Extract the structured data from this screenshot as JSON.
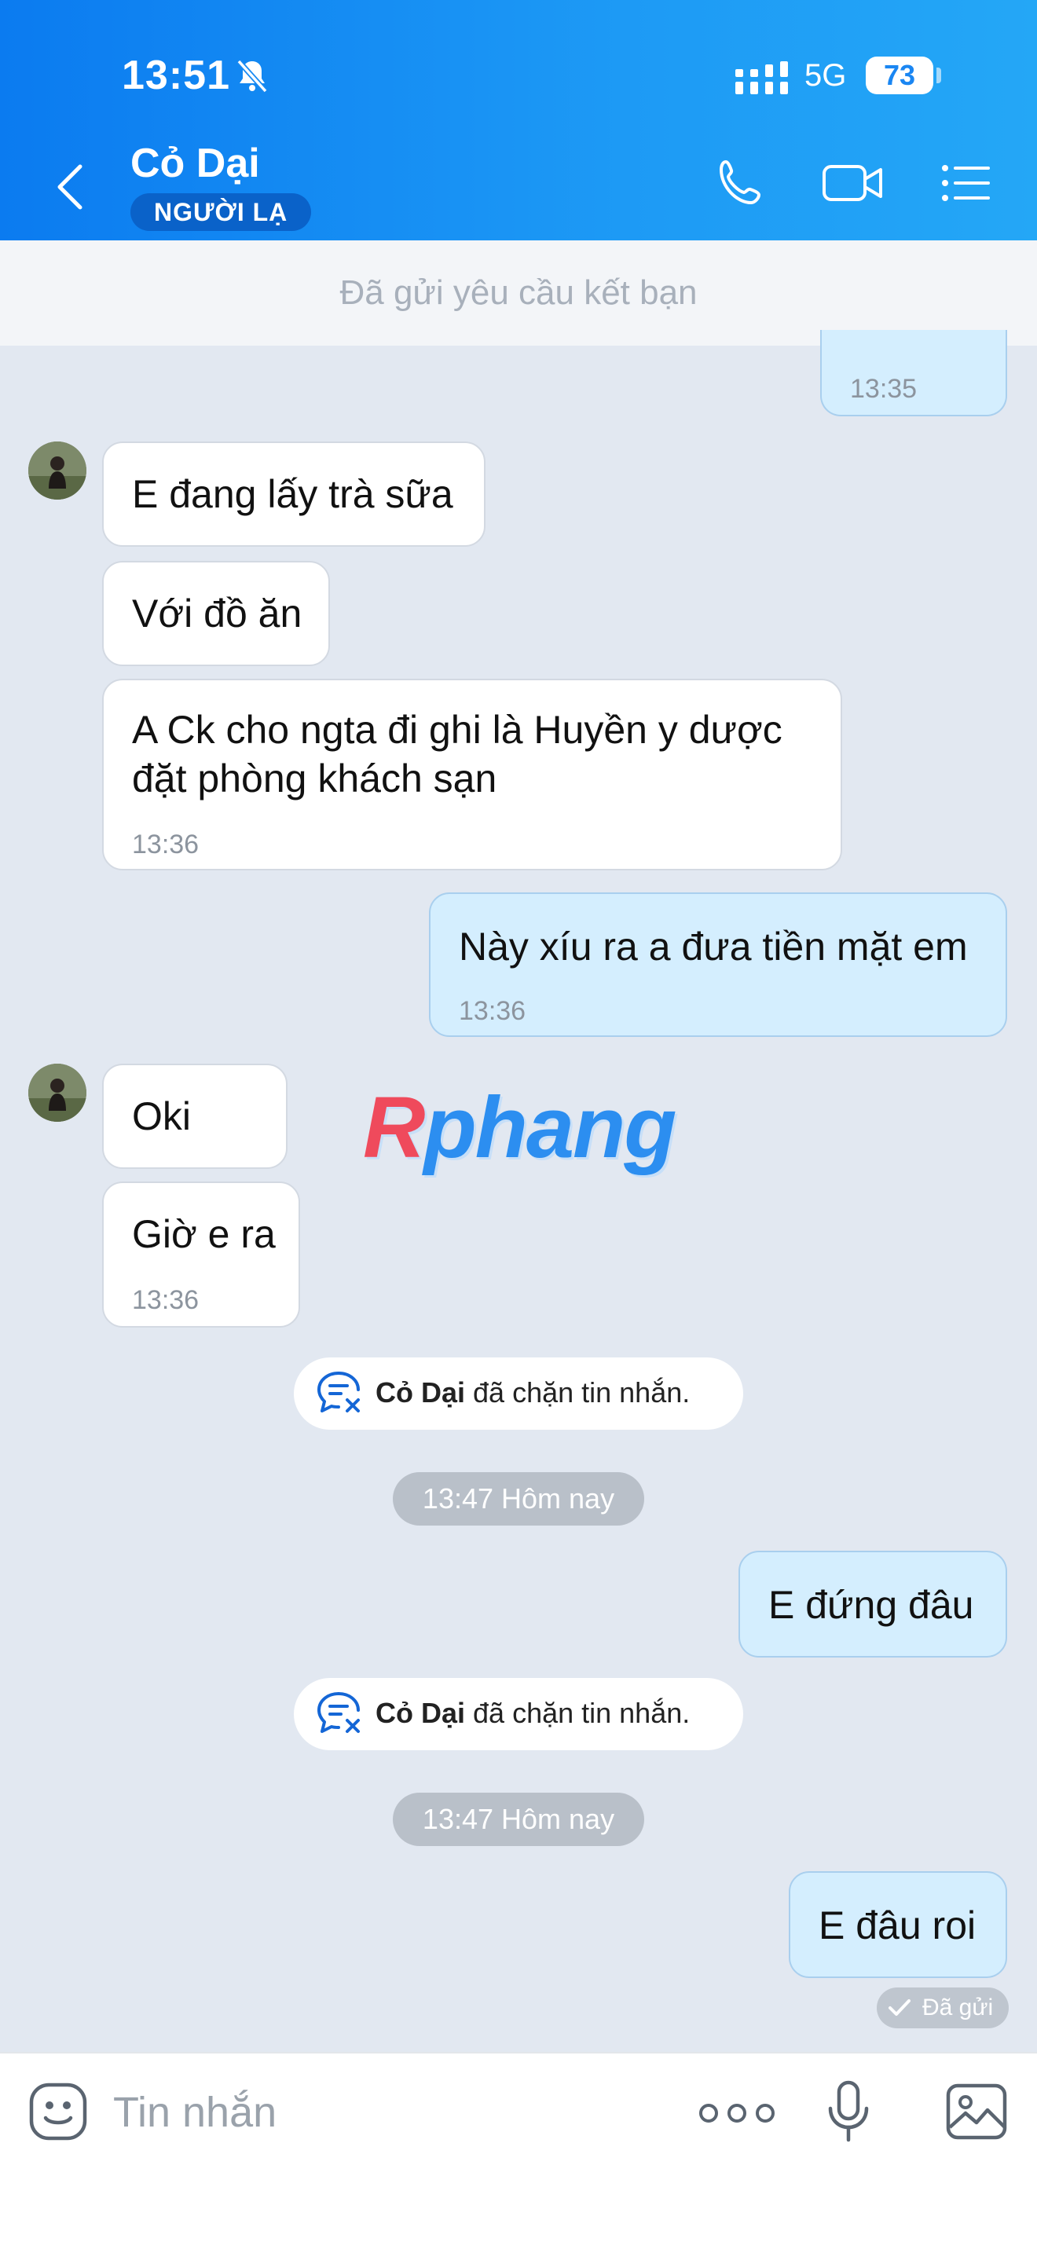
{
  "status_bar": {
    "time": "13:51",
    "network": "5G",
    "battery": "73"
  },
  "header": {
    "contact_name": "Cỏ Dại",
    "badge": "NGƯỜI LẠ"
  },
  "friend_request": {
    "text": "Đã gửi yêu cầu kết bạn"
  },
  "messages": [
    {
      "side": "out",
      "time": "13:35"
    },
    {
      "side": "in",
      "text": "E đang lấy trà sữa"
    },
    {
      "side": "in",
      "text": "Với đồ ăn"
    },
    {
      "side": "in",
      "text_line1": "A Ck cho ngta đi ghi là Huyền y dược",
      "text_line2": "đặt phòng khách sạn",
      "time": "13:36"
    },
    {
      "side": "out",
      "text": "Này xíu ra a đưa tiền mặt em",
      "time": "13:36"
    },
    {
      "side": "in",
      "text": "Oki"
    },
    {
      "side": "in",
      "text": "Giờ e ra",
      "time": "13:36"
    },
    {
      "side": "out",
      "text": "E đứng đâu"
    },
    {
      "side": "out",
      "text": "E đâu roi"
    }
  ],
  "system_notices": [
    {
      "name": "Cỏ Dại",
      "text": " đã chặn tin nhắn."
    },
    {
      "name": "Cỏ Dại",
      "text": " đã chặn tin nhắn."
    }
  ],
  "time_chips": [
    "13:47 Hôm nay",
    "13:47 Hôm nay"
  ],
  "sent_status": "Đã gửi",
  "watermark": {
    "first": "R",
    "rest": "phang"
  },
  "composer": {
    "placeholder": "Tin nhắn"
  },
  "colors": {
    "header_start": "#0b7bf0",
    "header_end": "#24a7f6",
    "incoming_bubble": "#ffffff",
    "outgoing_bubble": "#d4eefe",
    "chat_background": "#e2e8f1"
  },
  "icons": [
    "back-icon",
    "bell-off-icon",
    "signal-icon",
    "call-icon",
    "video-call-icon",
    "menu-list-icon",
    "blocked-message-icon",
    "emoji-icon",
    "more-icon",
    "mic-icon",
    "image-icon",
    "check-icon"
  ]
}
